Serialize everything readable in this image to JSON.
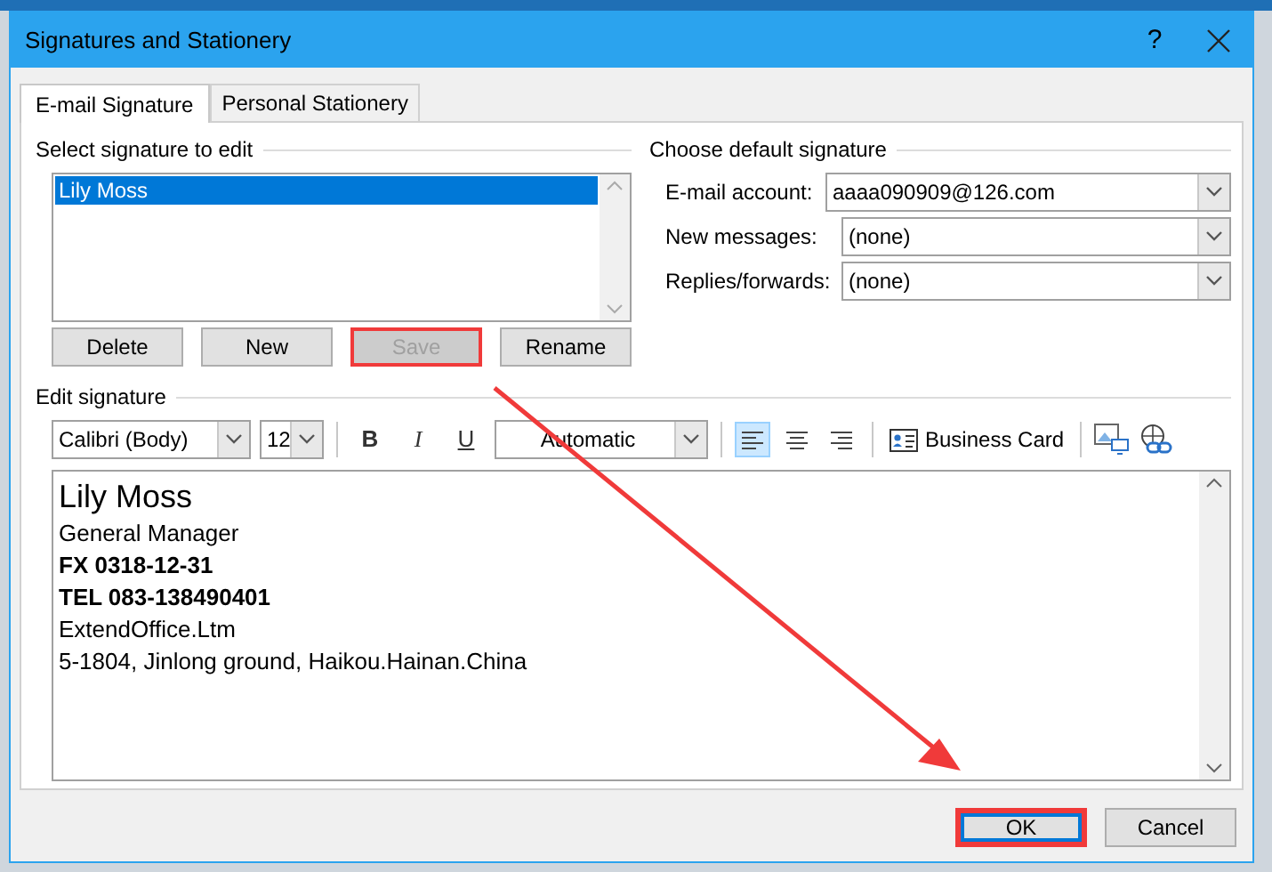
{
  "window": {
    "title": "Signatures and Stationery",
    "help": "?"
  },
  "tabs": [
    {
      "label": "E-mail Signature",
      "selected": true
    },
    {
      "label": "Personal Stationery",
      "selected": false
    }
  ],
  "select_signature": {
    "label": "Select signature to edit",
    "items": [
      {
        "name": "Lily Moss",
        "selected": true
      }
    ],
    "buttons": [
      {
        "label": "Delete",
        "disabled": false,
        "highlighted": false
      },
      {
        "label": "New",
        "disabled": false,
        "highlighted": false
      },
      {
        "label": "Save",
        "disabled": true,
        "highlighted": true
      },
      {
        "label": "Rename",
        "disabled": false,
        "highlighted": false
      }
    ]
  },
  "default_signature": {
    "label": "Choose default signature",
    "fields": [
      {
        "label": "E-mail account:",
        "value": "aaaa090909@126.com"
      },
      {
        "label": "New messages:",
        "value": "(none)"
      },
      {
        "label": "Replies/forwards:",
        "value": "(none)"
      }
    ]
  },
  "edit_signature": {
    "label": "Edit signature",
    "font": "Calibri (Body)",
    "size": "12",
    "font_color": "Automatic",
    "format_buttons": [
      {
        "kind": "bold",
        "glyph": "B"
      },
      {
        "kind": "italic",
        "glyph": "I"
      },
      {
        "kind": "underline",
        "glyph": "U"
      }
    ],
    "alignments": [
      {
        "kind": "left",
        "selected": true
      },
      {
        "kind": "center",
        "selected": false
      },
      {
        "kind": "right",
        "selected": false
      }
    ],
    "business_card": "Business Card",
    "lines": [
      {
        "kind": "name",
        "text": "Lily Moss"
      },
      {
        "kind": "plain",
        "text": "General Manager"
      },
      {
        "kind": "bold",
        "text": "FX 0318-12-31"
      },
      {
        "kind": "bold",
        "text": "TEL 083-138490401"
      },
      {
        "kind": "plain",
        "text": "ExtendOffice.Ltm"
      },
      {
        "kind": "plain",
        "text": "5-1804, Jinlong ground, Haikou.Hainan.China"
      }
    ]
  },
  "footer_buttons": [
    {
      "label": "OK",
      "highlighted": true,
      "default": true
    },
    {
      "label": "Cancel",
      "highlighted": false,
      "default": false
    }
  ]
}
